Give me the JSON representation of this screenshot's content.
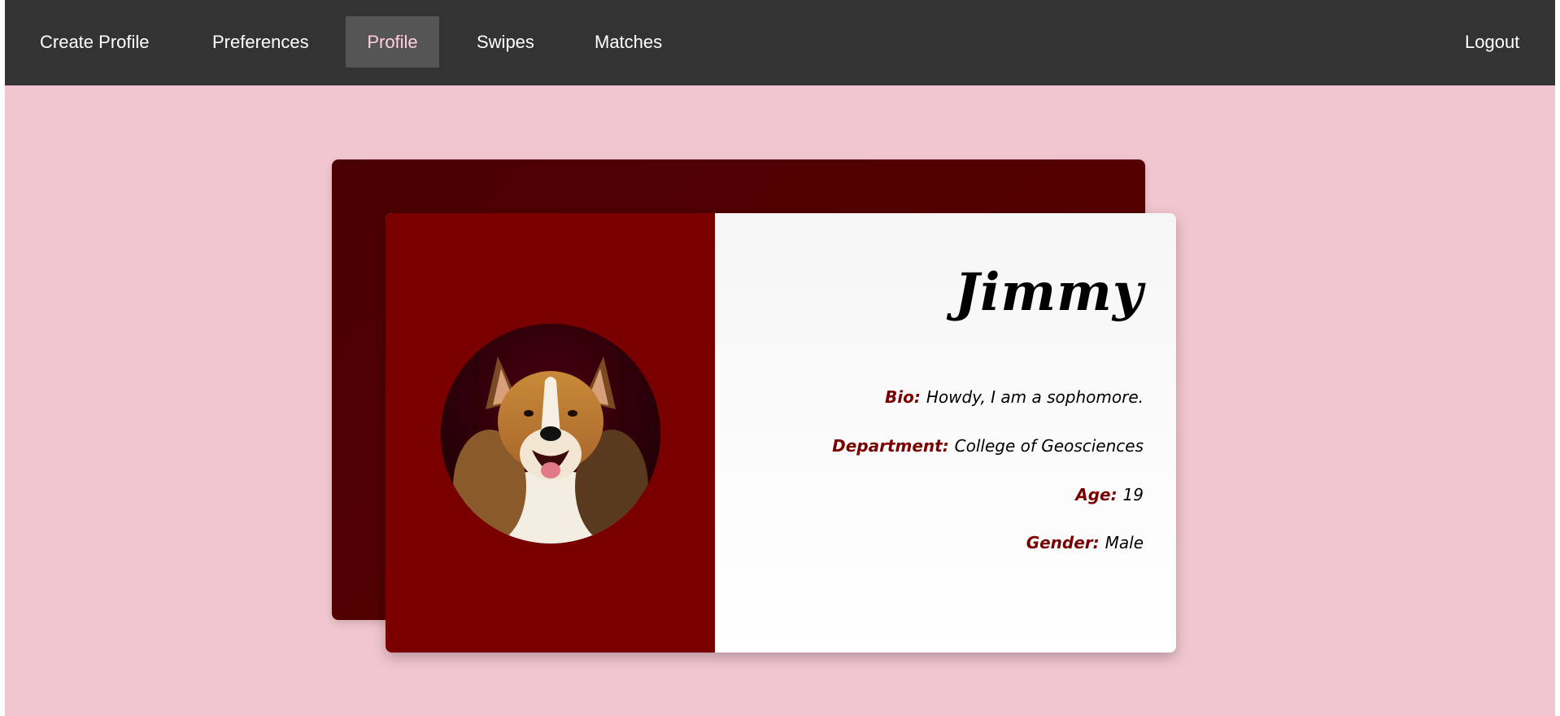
{
  "nav": {
    "items": [
      {
        "label": "Create Profile"
      },
      {
        "label": "Preferences"
      },
      {
        "label": "Profile"
      },
      {
        "label": "Swipes"
      },
      {
        "label": "Matches"
      }
    ],
    "active": "Profile",
    "logout_label": "Logout"
  },
  "profile": {
    "name": "Jimmy",
    "photo_icon": "collie-dog-photo",
    "bio_label": "Bio:",
    "bio": "Howdy, I am a sophomore.",
    "department_label": "Department:",
    "department": "College of Geosciences",
    "age_label": "Age:",
    "age": "19",
    "gender_label": "Gender:",
    "gender": "Male"
  },
  "colors": {
    "navbar": "#333333",
    "page_background": "#f2c6d0",
    "card_back": "#4b0000",
    "card_left": "#7a0000",
    "label_accent": "#7a0000",
    "active_nav_text": "#ffd0da"
  }
}
